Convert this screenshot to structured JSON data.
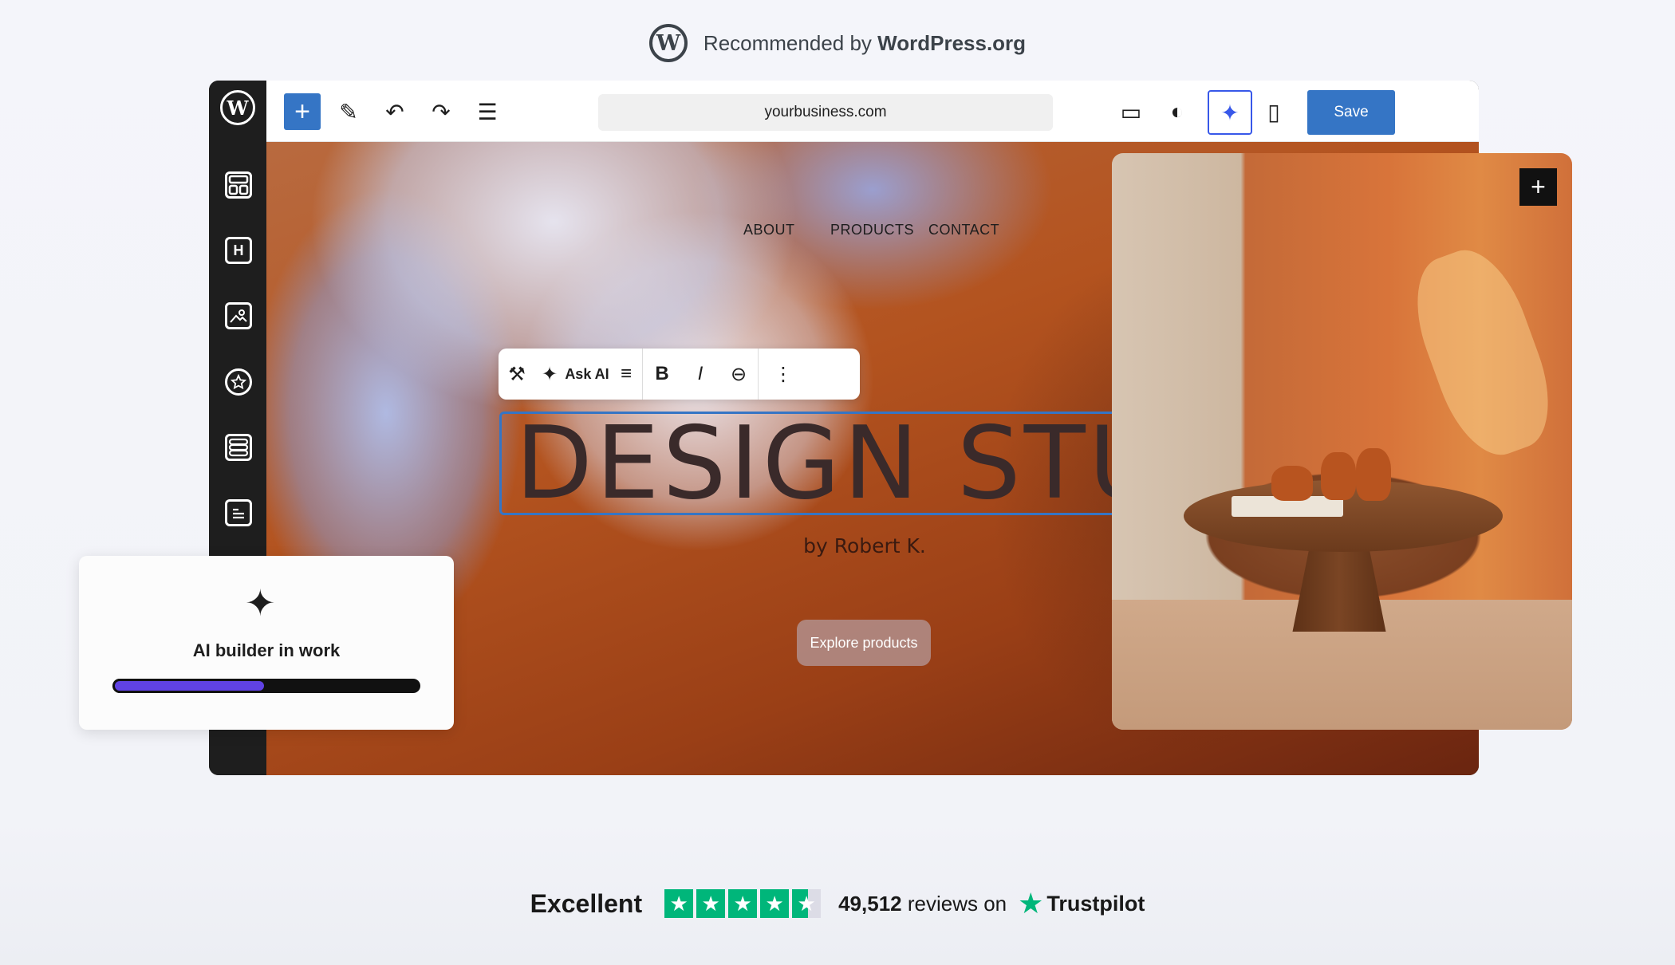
{
  "recommendation": {
    "logo_letter": "W",
    "prefix": "Recommended by ",
    "brand": "WordPress.org"
  },
  "sidebar": {
    "logo_letter": "W",
    "items": [
      {
        "icon": "patterns-icon"
      },
      {
        "icon": "heading-icon",
        "glyph": "H"
      },
      {
        "icon": "image-icon"
      },
      {
        "icon": "badge-icon"
      },
      {
        "icon": "layout-icon"
      },
      {
        "icon": "text-block-icon"
      }
    ]
  },
  "toolbar": {
    "add": "+",
    "pen": "✎",
    "undo": "↶",
    "redo": "↷",
    "outline": "☰",
    "url": "yourbusiness.com",
    "device": "▭",
    "contrast": "◐",
    "wand": "✦",
    "panel": "▯",
    "save_label": "Save"
  },
  "canvas": {
    "nav": [
      "ABOUT",
      "PRODUCTS",
      "CONTACT"
    ],
    "block_toolbar": {
      "hammer": "⚒",
      "ai_spark": "✦",
      "ask_ai": "Ask AI",
      "align": "≡",
      "bold": "B",
      "italic": "I",
      "link": "⊖",
      "more": "⋮"
    },
    "heading": "DESIGN STUDIO",
    "byline": "by Robert K.",
    "cta": "Explore products",
    "photo_add": "+"
  },
  "ai_builder": {
    "spark": "✦",
    "title": "AI builder in work",
    "progress": 0.5
  },
  "trust": {
    "rating_word": "Excellent",
    "stars": 4.5,
    "review_count": "49,512",
    "reviews_suffix": " reviews on",
    "platform": "Trustpilot",
    "star_color": "#00b67a"
  },
  "colors": {
    "accent": "#3575c5",
    "ai_progress": "#6042e3",
    "sidebar": "#1e1e1e"
  }
}
